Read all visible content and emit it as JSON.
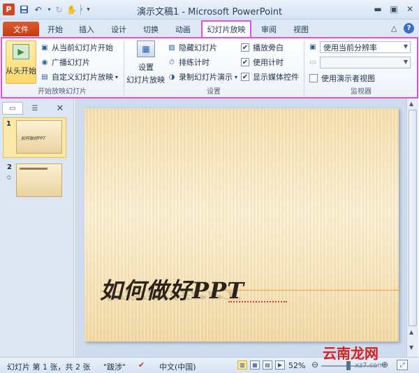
{
  "window": {
    "title": "演示文稿1 - Microsoft PowerPoint",
    "app_icon": "P"
  },
  "quick_access": {
    "icons": [
      "powerpoint-icon",
      "save-icon",
      "undo-icon",
      "redo-icon",
      "touch-icon",
      "customize-icon"
    ]
  },
  "tabs": {
    "file": "文件",
    "home": "开始",
    "insert": "插入",
    "design": "设计",
    "transitions": "切换",
    "animations": "动画",
    "slideshow": "幻灯片放映",
    "review": "审阅",
    "view": "视图"
  },
  "ribbon": {
    "start_group": {
      "label": "开始放映幻灯片",
      "from_begin": "从头开始",
      "from_current": "从当前幻灯片开始",
      "broadcast": "广播幻灯片",
      "custom": "自定义幻灯片放映"
    },
    "setup_group": {
      "label": "设置",
      "setup_line1": "设置",
      "setup_line2": "幻灯片放映",
      "hide_slide": "隐藏幻灯片",
      "rehearse": "排练计时",
      "record": "录制幻灯片演示",
      "play_narration": "播放旁白",
      "use_timing": "使用计时",
      "show_media": "显示媒体控件"
    },
    "monitor_group": {
      "label": "监视器",
      "resolution": "使用当前分辨率",
      "monitor": "",
      "presenter_view": "使用演示者视图"
    },
    "checkbox_state": {
      "play_narration": true,
      "use_timing": true,
      "show_media": true,
      "presenter_view": false
    }
  },
  "slides_panel": {
    "slides_tab_icon": "slides-icon",
    "outline_tab_icon": "outline-icon",
    "close": "✕",
    "thumb1_num": "1",
    "thumb1_text": "如何做好PPT",
    "thumb2_num": "2",
    "star": "✩"
  },
  "slide": {
    "title": "如何做好PPT"
  },
  "status": {
    "slide_info": "幻灯片 第 1 张，共 2 张",
    "theme": "\"跋涉\"",
    "language": "中文(中国)",
    "zoom": "52%",
    "zoom_fraction": 0.52
  },
  "watermark": {
    "text": "云南龙网",
    "domain": "xz7.com"
  },
  "colors": {
    "file_tab": "#c03c17",
    "highlight_border": "#e050e0",
    "selected_button": "#ffd86a"
  }
}
